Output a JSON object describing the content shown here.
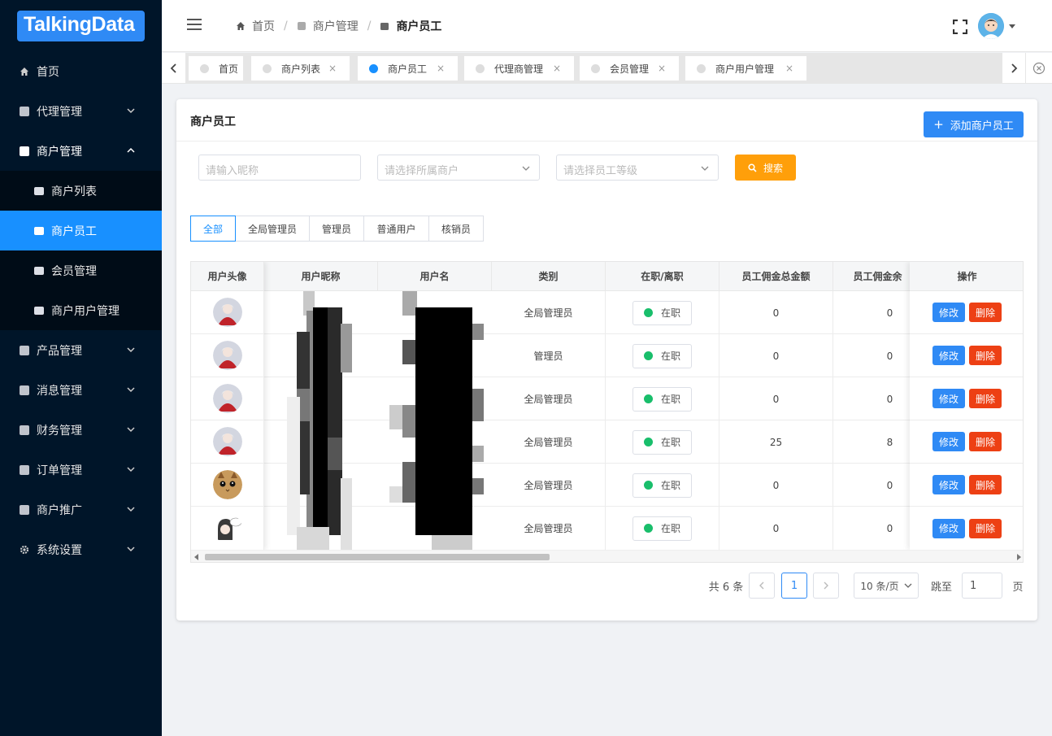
{
  "logo": "TalkingData",
  "sidebar": {
    "items": [
      {
        "label": "首页"
      },
      {
        "label": "代理管理"
      },
      {
        "label": "商户管理"
      },
      {
        "label": "商户列表"
      },
      {
        "label": "商户员工"
      },
      {
        "label": "会员管理"
      },
      {
        "label": "商户用户管理"
      },
      {
        "label": "产品管理"
      },
      {
        "label": "消息管理"
      },
      {
        "label": "财务管理"
      },
      {
        "label": "订单管理"
      },
      {
        "label": "商户推广"
      },
      {
        "label": "系统设置"
      }
    ]
  },
  "breadcrumb": {
    "home": "首页",
    "parent": "商户管理",
    "current": "商户员工"
  },
  "tabs": [
    {
      "label": "首页"
    },
    {
      "label": "商户列表"
    },
    {
      "label": "商户员工"
    },
    {
      "label": "代理商管理"
    },
    {
      "label": "会员管理"
    },
    {
      "label": "商户用户管理"
    }
  ],
  "tab_close": "×",
  "card": {
    "title": "商户员工",
    "add_button": "添加商户员工"
  },
  "filters": {
    "nickname_placeholder": "请输入昵称",
    "merchant_placeholder": "请选择所属商户",
    "level_placeholder": "请选择员工等级",
    "search_button": "搜索"
  },
  "role_tabs": [
    "全部",
    "全局管理员",
    "管理员",
    "普通用户",
    "核销员"
  ],
  "table": {
    "headers": [
      "用户头像",
      "用户昵称",
      "用户名",
      "类别",
      "在职/离职",
      "员工佣金总金额",
      "员工佣金余",
      "操作"
    ],
    "rows": [
      {
        "category": "全局管理员",
        "status": "在职",
        "total": "0",
        "balance": "0"
      },
      {
        "category": "管理员",
        "status": "在职",
        "total": "0",
        "balance": "0"
      },
      {
        "category": "全局管理员",
        "status": "在职",
        "total": "0",
        "balance": "0"
      },
      {
        "category": "全局管理员",
        "status": "在职",
        "total": "25",
        "balance": "8"
      },
      {
        "category": "全局管理员",
        "status": "在职",
        "total": "0",
        "balance": "0"
      },
      {
        "category": "全局管理员",
        "status": "在职",
        "total": "0",
        "balance": "0"
      }
    ],
    "edit_label": "修改",
    "delete_label": "删除"
  },
  "pagination": {
    "total_text": "共 6 条",
    "current_page": "1",
    "page_size": "10 条/页",
    "jump_label": "跳至",
    "jump_value": "1",
    "page_suffix": "页"
  },
  "colors": {
    "sidebar": "#001529",
    "primary": "#2f8af5",
    "active_menu": "#1890ff",
    "search": "#ff9f0a",
    "danger": "#ed4014",
    "success": "#19be6b"
  }
}
